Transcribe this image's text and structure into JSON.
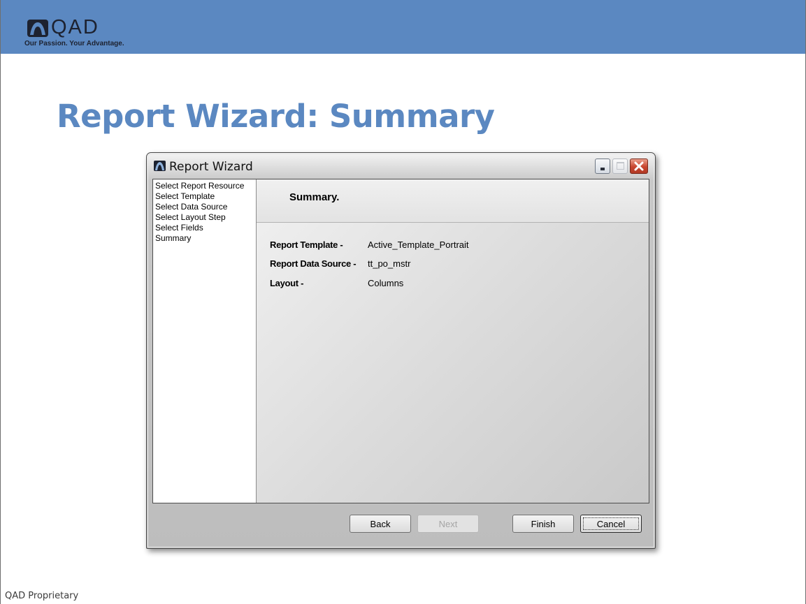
{
  "brand": {
    "logo_text": "QAD",
    "tagline": "Our Passion. Your Advantage."
  },
  "slide": {
    "title": "Report Wizard: Summary",
    "footer": "QAD Proprietary"
  },
  "window": {
    "title": "Report Wizard",
    "controls": [
      "minimize",
      "maximize",
      "close"
    ]
  },
  "steps": [
    "Select Report Resource",
    "Select Template",
    "Select Data Source",
    "Select Layout Step",
    "Select Fields",
    "Summary"
  ],
  "panel": {
    "heading": "Summary.",
    "rows": [
      {
        "label": "Report Template -",
        "value": "Active_Template_Portrait"
      },
      {
        "label": "Report Data Source -",
        "value": "tt_po_mstr"
      },
      {
        "label": "Layout -",
        "value": "Columns"
      }
    ]
  },
  "buttons": {
    "back": "Back",
    "next": "Next",
    "finish": "Finish",
    "cancel": "Cancel"
  },
  "colors": {
    "banner": "#5b88c1",
    "title": "#5b88c1",
    "close_button": "#c8452e"
  },
  "icons": {
    "logo": "qad-logo-icon",
    "window": "qad-window-icon",
    "minimize": "minimize-icon",
    "maximize": "maximize-icon",
    "close": "close-icon"
  }
}
